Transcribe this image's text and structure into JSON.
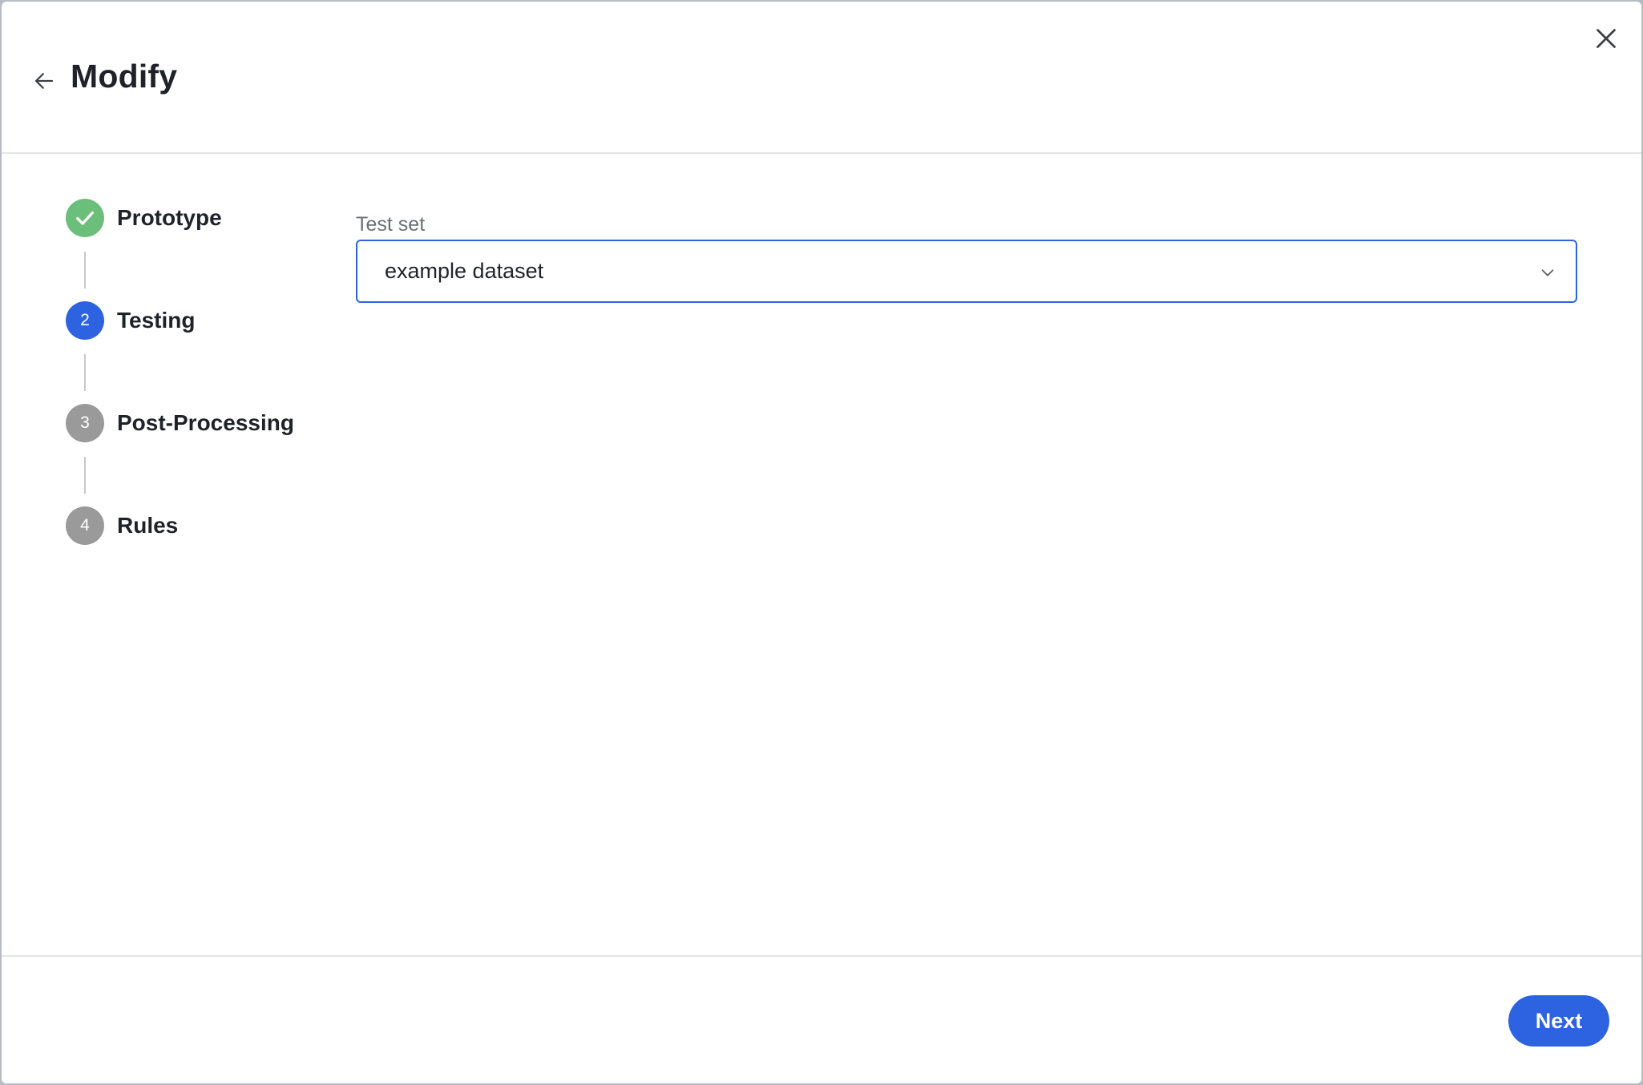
{
  "header": {
    "title": "Modify",
    "back_icon": "arrow-left-icon",
    "close_icon": "close-icon"
  },
  "stepper": {
    "steps": [
      {
        "number": "1",
        "label": "Prototype",
        "state": "completed",
        "icon": "check-icon"
      },
      {
        "number": "2",
        "label": "Testing",
        "state": "active"
      },
      {
        "number": "3",
        "label": "Post-Processing",
        "state": "pending"
      },
      {
        "number": "4",
        "label": "Rules",
        "state": "pending"
      }
    ]
  },
  "form": {
    "test_set": {
      "label": "Test set",
      "value": "example dataset",
      "icon": "chevron-down-icon"
    }
  },
  "footer": {
    "next_label": "Next"
  },
  "colors": {
    "primary": "#2d63e0",
    "completed": "#6cbf7b",
    "pending": "#9a9a9a",
    "text": "#1f2329",
    "muted_text": "#6b6f75",
    "border": "#e3e5e8"
  }
}
